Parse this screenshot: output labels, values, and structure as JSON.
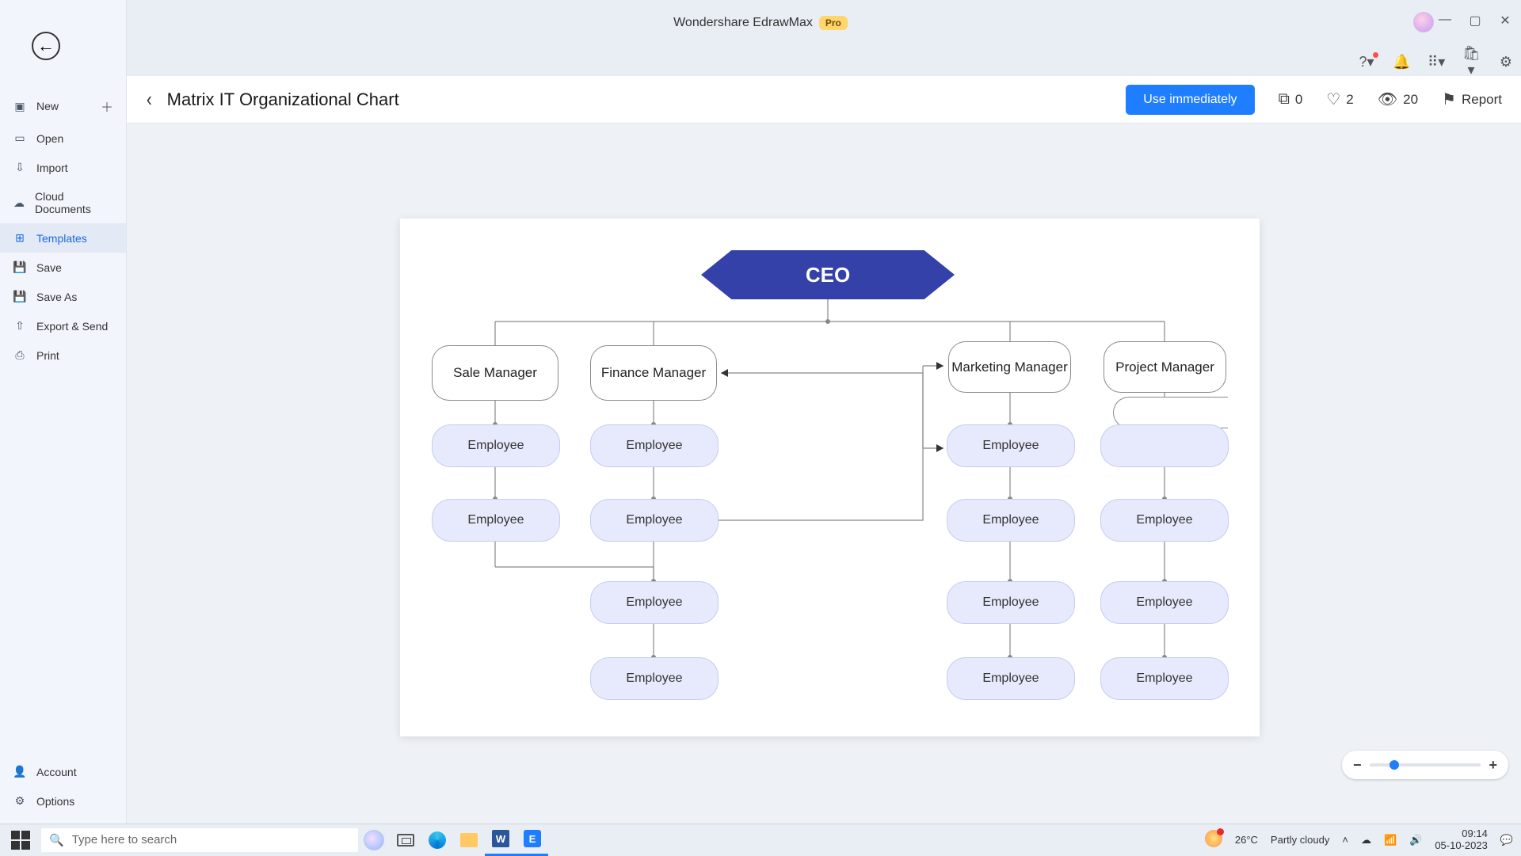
{
  "app": {
    "title": "Wondershare EdrawMax",
    "badge": "Pro"
  },
  "window_controls": {
    "minimize": "—",
    "maximize": "▢",
    "close": "✕"
  },
  "toolbar_icons": {
    "help": "?",
    "bell": "🔔",
    "grid": "⠿",
    "bag": "🛍",
    "gear": "⚙"
  },
  "sidebar": {
    "items": [
      {
        "id": "new",
        "icon": "＋",
        "label": "New",
        "has_add": true
      },
      {
        "id": "open",
        "icon": "▭",
        "label": "Open"
      },
      {
        "id": "import",
        "icon": "⇩",
        "label": "Import"
      },
      {
        "id": "cloud",
        "icon": "☁",
        "label": "Cloud Documents"
      },
      {
        "id": "templates",
        "icon": "⊞",
        "label": "Templates",
        "selected": true
      },
      {
        "id": "save",
        "icon": "💾",
        "label": "Save"
      },
      {
        "id": "saveas",
        "icon": "💾",
        "label": "Save As"
      },
      {
        "id": "export",
        "icon": "⇧",
        "label": "Export & Send"
      },
      {
        "id": "print",
        "icon": "⎙",
        "label": "Print"
      }
    ],
    "bottom": [
      {
        "id": "account",
        "icon": "👤",
        "label": "Account"
      },
      {
        "id": "options",
        "icon": "⚙",
        "label": "Options"
      }
    ]
  },
  "doc": {
    "title": "Matrix IT Organizational Chart",
    "use_button": "Use immediately",
    "stats": {
      "copies": "0",
      "likes": "2",
      "views": "20",
      "report": "Report"
    }
  },
  "chart": {
    "ceo": "CEO",
    "managers": {
      "sale": "Sale Manager",
      "finance": "Finance Manager",
      "marketing": "Marketing Manager",
      "project": "Project Manager"
    },
    "employee_label": "Employee"
  },
  "taskbar": {
    "search_placeholder": "Type here to search",
    "weather_temp": "26°C",
    "weather_desc": "Partly cloudy",
    "time": "09:14",
    "date": "05-10-2023"
  }
}
